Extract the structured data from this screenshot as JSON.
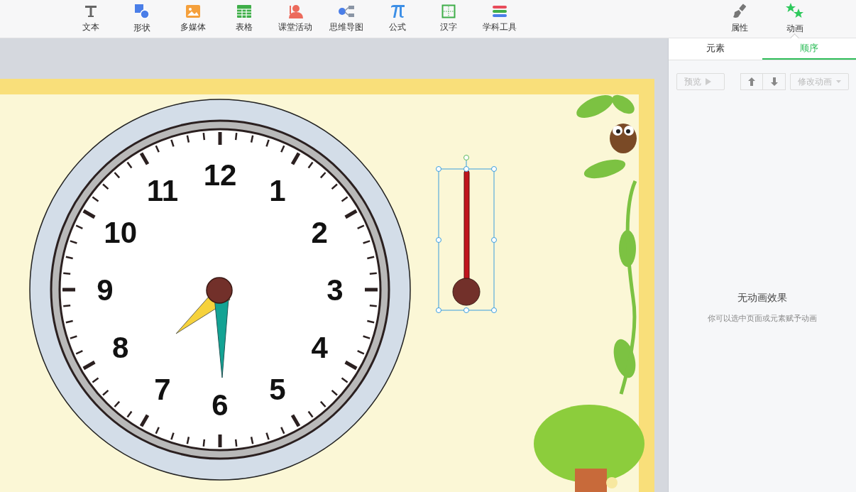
{
  "toolbar": {
    "tools": [
      {
        "kind": "text",
        "label": "文本"
      },
      {
        "kind": "shape",
        "label": "形状"
      },
      {
        "kind": "media",
        "label": "多媒体"
      },
      {
        "kind": "table",
        "label": "表格"
      },
      {
        "kind": "activity",
        "label": "课堂活动"
      },
      {
        "kind": "mindmap",
        "label": "思维导图"
      },
      {
        "kind": "formula",
        "label": "公式"
      },
      {
        "kind": "hanzi",
        "label": "汉字"
      },
      {
        "kind": "subject",
        "label": "学科工具"
      }
    ]
  },
  "panel_tabs": [
    {
      "kind": "brush",
      "label": "属性",
      "selected": false
    },
    {
      "kind": "stars",
      "label": "动画",
      "selected": true
    }
  ],
  "sub_tabs": [
    {
      "label": "元素",
      "selected": false
    },
    {
      "label": "顺序",
      "selected": true
    }
  ],
  "actions": {
    "preview": {
      "label": "预览",
      "disabled": true
    },
    "edit": {
      "label": "修改动画",
      "disabled": true
    }
  },
  "empty_state": {
    "title": "无动画效果",
    "hint": "你可以选中页面或元素赋予动画"
  },
  "clock": {
    "numbers": [
      "12",
      "1",
      "2",
      "3",
      "4",
      "5",
      "6",
      "7",
      "8",
      "9",
      "10",
      "11"
    ]
  },
  "thermometer": {
    "selected": true
  }
}
